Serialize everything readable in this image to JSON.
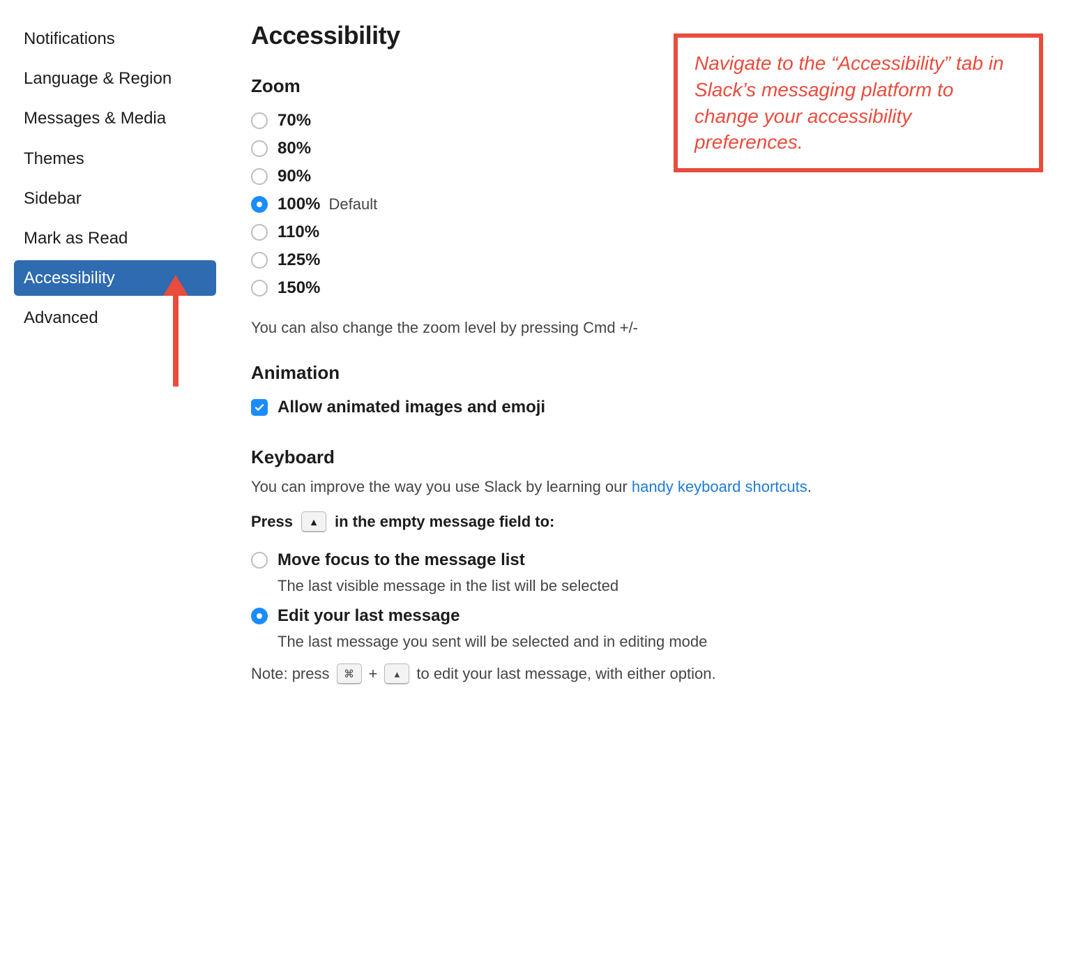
{
  "sidebar": {
    "items": [
      {
        "label": "Notifications"
      },
      {
        "label": "Language & Region"
      },
      {
        "label": "Messages & Media"
      },
      {
        "label": "Themes"
      },
      {
        "label": "Sidebar"
      },
      {
        "label": "Mark as Read"
      },
      {
        "label": "Accessibility",
        "active": true
      },
      {
        "label": "Advanced"
      }
    ]
  },
  "annotation": {
    "text": "Navigate to the “Accessibility” tab in Slack’s messaging platform to change your accessibility preferences."
  },
  "main": {
    "title": "Accessibility",
    "zoom": {
      "heading": "Zoom",
      "options": [
        {
          "label": "70%",
          "selected": false
        },
        {
          "label": "80%",
          "selected": false
        },
        {
          "label": "90%",
          "selected": false
        },
        {
          "label": "100%",
          "suffix": "Default",
          "selected": true
        },
        {
          "label": "110%",
          "selected": false
        },
        {
          "label": "125%",
          "selected": false
        },
        {
          "label": "150%",
          "selected": false
        }
      ],
      "hint": "You can also change the zoom level by pressing Cmd +/-"
    },
    "animation": {
      "heading": "Animation",
      "allow_label": "Allow animated images and emoji",
      "allow_checked": true
    },
    "keyboard": {
      "heading": "Keyboard",
      "intro_prefix": "You can improve the way you use Slack by learning our ",
      "intro_link": "handy keyboard shortcuts",
      "intro_suffix": ".",
      "press_prefix": "Press",
      "press_suffix": "in the empty message field to:",
      "options": [
        {
          "label": "Move focus to the message list",
          "sub": "The last visible message in the list will be selected",
          "selected": false
        },
        {
          "label": "Edit your last message",
          "sub": "The last message you sent will be selected and in editing mode",
          "selected": true
        }
      ],
      "note_prefix": "Note: press",
      "note_plus": "+",
      "note_suffix": "to edit your last message, with either option.",
      "key_cmd": "⌘",
      "key_up": "▴"
    }
  }
}
